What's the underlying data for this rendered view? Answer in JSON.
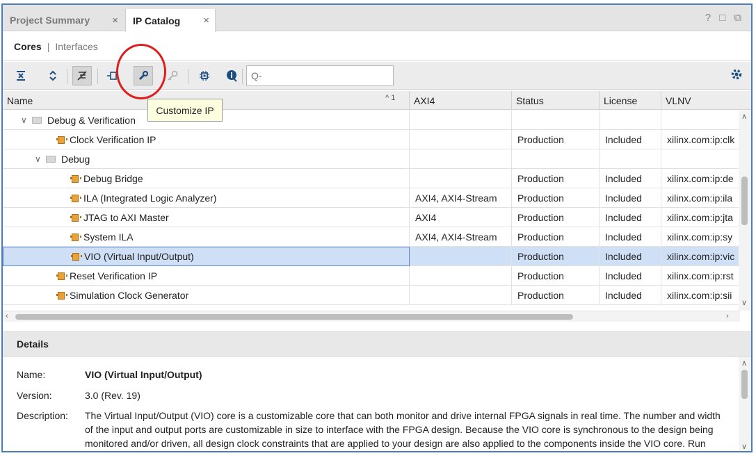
{
  "tabs": [
    {
      "label": "Project Summary",
      "close": "×"
    },
    {
      "label": "IP Catalog",
      "close": "×"
    }
  ],
  "window_controls": [
    "?",
    "□",
    "⧉"
  ],
  "subtabs": {
    "cores": "Cores",
    "separator": "|",
    "interfaces": "Interfaces"
  },
  "toolbar": {
    "search_placeholder": "Q-",
    "tooltip": "Customize IP"
  },
  "table": {
    "headers": [
      "Name",
      "AXI4",
      "Status",
      "License",
      "VLNV"
    ],
    "sort_indicator": "^ 1",
    "rows": [
      {
        "name": "Debug & Verification",
        "axi": "",
        "status": "",
        "license": "",
        "vlnv": ""
      },
      {
        "name": "Clock Verification IP",
        "axi": "",
        "status": "Production",
        "license": "Included",
        "vlnv": "xilinx.com:ip:clk"
      },
      {
        "name": "Debug",
        "axi": "",
        "status": "",
        "license": "",
        "vlnv": ""
      },
      {
        "name": "Debug Bridge",
        "axi": "",
        "status": "Production",
        "license": "Included",
        "vlnv": "xilinx.com:ip:de"
      },
      {
        "name": "ILA (Integrated Logic Analyzer)",
        "axi": "AXI4, AXI4-Stream",
        "status": "Production",
        "license": "Included",
        "vlnv": "xilinx.com:ip:ila"
      },
      {
        "name": "JTAG to AXI Master",
        "axi": "AXI4",
        "status": "Production",
        "license": "Included",
        "vlnv": "xilinx.com:ip:jta"
      },
      {
        "name": "System ILA",
        "axi": "AXI4, AXI4-Stream",
        "status": "Production",
        "license": "Included",
        "vlnv": "xilinx.com:ip:sy"
      },
      {
        "name": "VIO (Virtual Input/Output)",
        "axi": "",
        "status": "Production",
        "license": "Included",
        "vlnv": "xilinx.com:ip:vic"
      },
      {
        "name": "Reset Verification IP",
        "axi": "",
        "status": "Production",
        "license": "Included",
        "vlnv": "xilinx.com:ip:rst"
      },
      {
        "name": "Simulation Clock Generator",
        "axi": "",
        "status": "Production",
        "license": "Included",
        "vlnv": "xilinx.com:ip:sii"
      }
    ]
  },
  "details": {
    "title": "Details",
    "name_label": "Name:",
    "name_value": "VIO (Virtual Input/Output)",
    "version_label": "Version:",
    "version_value": "3.0 (Rev. 19)",
    "description_label": "Description:",
    "description_value": "The Virtual Input/Output (VIO) core is a customizable core that can both monitor and drive internal FPGA signals in real time. The number and width of the input and output ports are customizable in size to interface with the FPGA design. Because the VIO core is synchronous to the design being monitored and/or driven, all design clock constraints that are applied to your design are also applied to the components inside the VIO core. Run time interaction with this core requires the use of the Vivado logic analyzer feature."
  },
  "colors": {
    "accent": "#1d4e82",
    "selected_row": "#cfdff5",
    "annotation": "#dd1e1e",
    "tooltip_bg": "#fdfde0"
  }
}
